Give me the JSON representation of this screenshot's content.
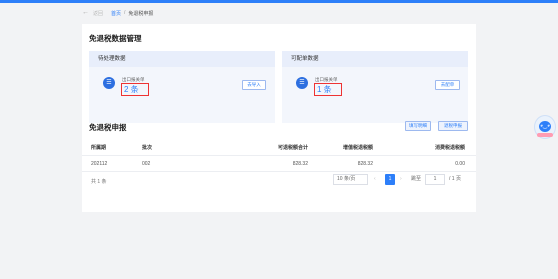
{
  "breadcrumb": {
    "back_glyph": "←",
    "back_label": "返回",
    "home": "首页",
    "separator": "/",
    "current": "免退税申报"
  },
  "data_mgmt": {
    "title": "免退税数据管理",
    "pending": {
      "header": "待处理数据",
      "label": "出口报关单",
      "count": "2 条",
      "button": "去导入"
    },
    "declarable": {
      "header": "可配单数据",
      "label": "出口报关单",
      "count": "1 条",
      "button": "去配单"
    }
  },
  "declaration": {
    "title": "免退税申报",
    "btn_export": "填写明细",
    "btn_declare": "退税申报",
    "columns": [
      "所属期",
      "批次",
      "可退税额合计",
      "增值税退税额",
      "消费税退税额"
    ],
    "rows": [
      [
        "202112",
        "002",
        "828.32",
        "828.32",
        "0.00"
      ]
    ],
    "total": "共 1 条"
  },
  "pagination": {
    "page_size": "10 条/页",
    "prev": "‹",
    "current_page": "1",
    "next": "›",
    "goto_label": "跳至",
    "goto_value": "1",
    "pages_label": "/ 1 页"
  },
  "assistant": {
    "face_glyph": "◕‿◕"
  }
}
